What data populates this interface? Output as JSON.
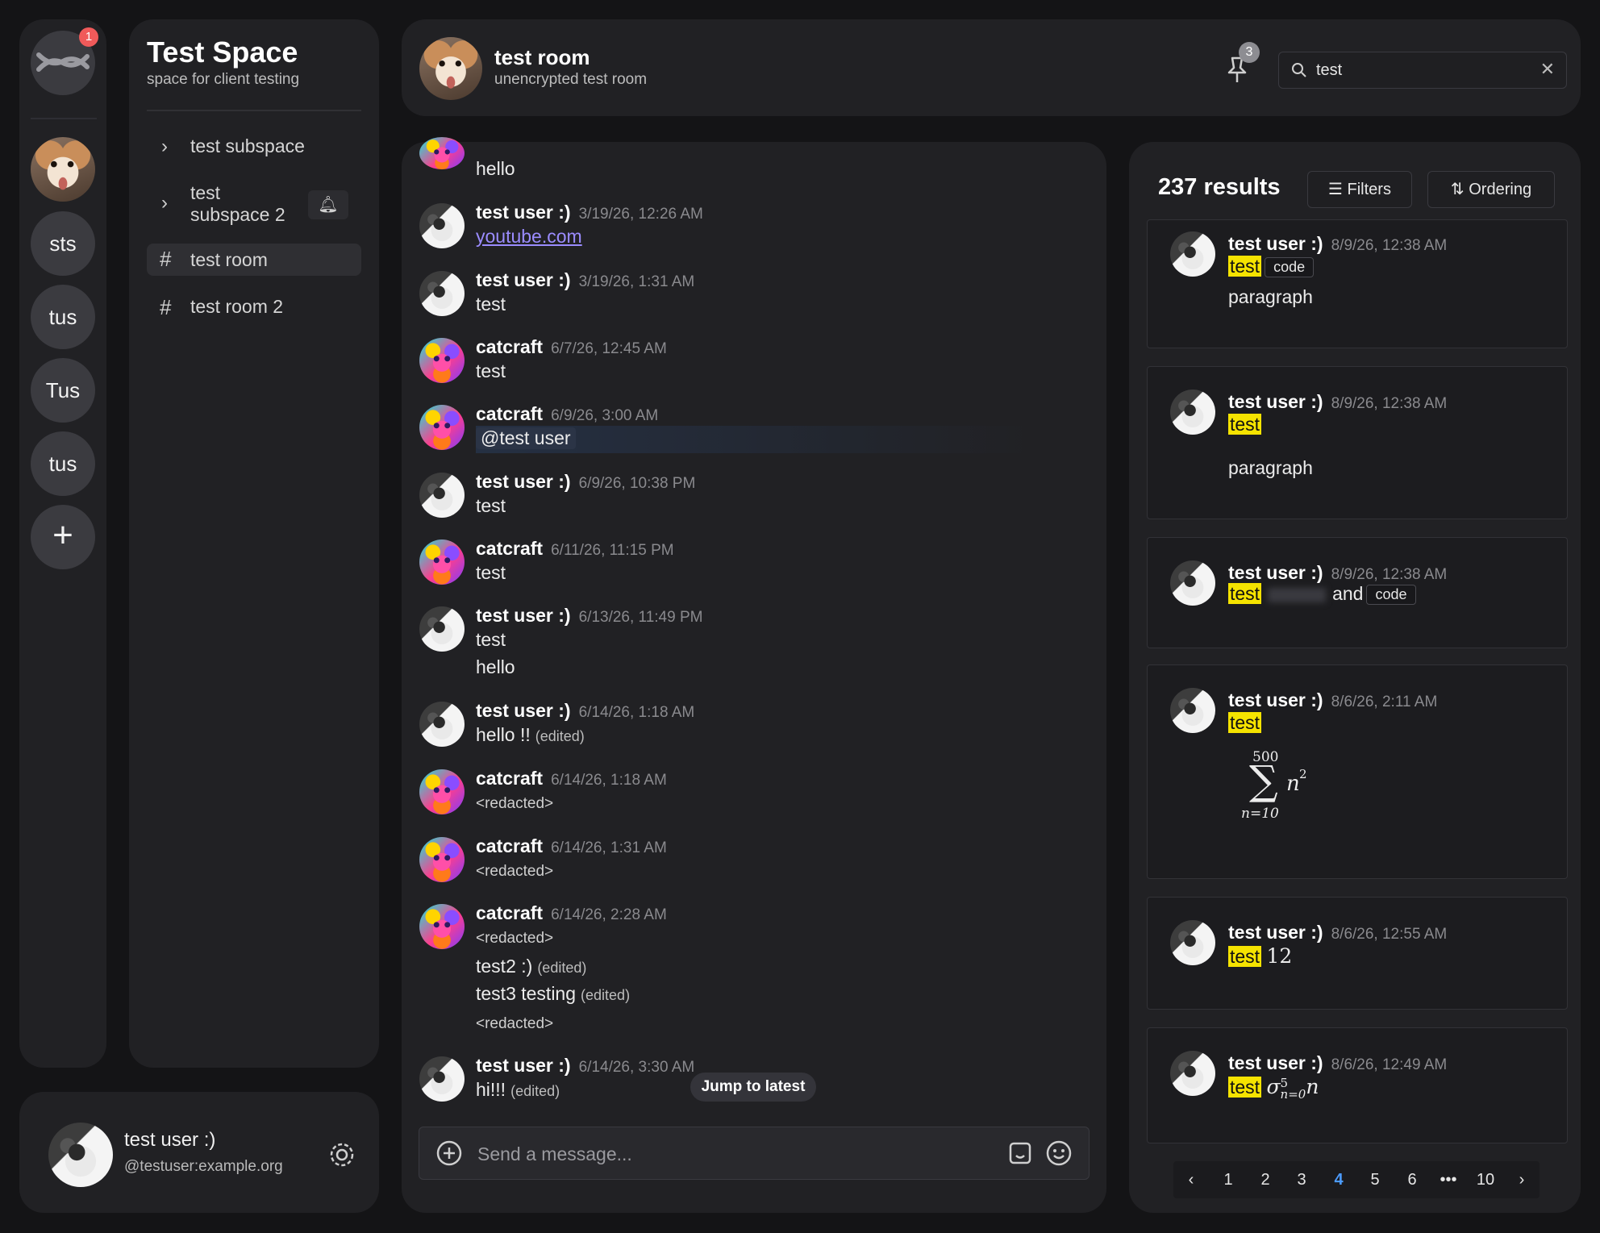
{
  "rail": {
    "notification_badge": "1",
    "spaces": [
      "sts",
      "tus",
      "Tus",
      "tus"
    ],
    "add_label": "+"
  },
  "sidebar": {
    "space_title": "Test Space",
    "space_subtitle": "space for client testing",
    "items": [
      {
        "label": "test subspace",
        "icon": "chevron-right-icon"
      },
      {
        "label_line1": "test",
        "label_line2": "subspace 2",
        "icon": "chevron-right-icon"
      },
      {
        "label": "test room",
        "icon": "hash-icon",
        "active": true
      },
      {
        "label": "test room 2",
        "icon": "hash-icon"
      }
    ]
  },
  "me": {
    "name": "test user :)",
    "id": "@testuser:example.org"
  },
  "header": {
    "room_name": "test room",
    "room_topic": "unencrypted test room",
    "pins_count": "3",
    "search_value": "test"
  },
  "messages": [
    {
      "body": "hello"
    },
    {
      "name": "test user :)",
      "ts": "3/19/26, 12:26 AM",
      "body": "youtube.com"
    },
    {
      "name": "test user :)",
      "ts": "3/19/26, 1:31 AM",
      "body": "test"
    },
    {
      "name": "catcraft",
      "ts": "6/7/26, 12:45 AM",
      "body": "test"
    },
    {
      "name": "catcraft",
      "ts": "6/9/26, 3:00 AM",
      "body": "@test user"
    },
    {
      "name": "test user :)",
      "ts": "6/9/26, 10:38 PM",
      "body": "test"
    },
    {
      "name": "catcraft",
      "ts": "6/11/26, 11:15 PM",
      "body": "test"
    },
    {
      "name": "test user :)",
      "ts": "6/13/26, 11:49 PM",
      "body": "test",
      "body2": "hello"
    },
    {
      "name": "test user :)",
      "ts": "6/14/26, 1:18 AM",
      "body": "hello !!",
      "edited": "(edited)"
    },
    {
      "name": "catcraft",
      "ts": "6/14/26, 1:18 AM",
      "body": "<redacted>"
    },
    {
      "name": "catcraft",
      "ts": "6/14/26, 1:31 AM",
      "body": "<redacted>"
    },
    {
      "name": "catcraft",
      "ts": "6/14/26, 2:28 AM",
      "body": "<redacted>",
      "body2": "test2 :)",
      "body3": "test3 testing",
      "body4": "<redacted>",
      "edited": "(edited)"
    },
    {
      "name": "test user :)",
      "ts": "6/14/26, 3:30 AM",
      "body": "hi!!!",
      "edited": "(edited)"
    }
  ],
  "jump_to_latest": "Jump to latest",
  "composer": {
    "placeholder": "Send a message..."
  },
  "results": {
    "count": "237 results",
    "filters_label": "Filters",
    "ordering_label": "Ordering",
    "cards": [
      {
        "name": "test user :)",
        "ts": "8/9/26, 12:38 AM",
        "hl": "test",
        "code": "code",
        "extra": "paragraph"
      },
      {
        "name": "test user :)",
        "ts": "8/9/26, 12:38 AM",
        "hl": "test",
        "extra": "paragraph"
      },
      {
        "name": "test user :)",
        "ts": "8/9/26, 12:38 AM",
        "hl": "test",
        "and": "and",
        "code": "code"
      },
      {
        "name": "test user :)",
        "ts": "8/6/26, 2:11 AM",
        "hl": "test",
        "sum_top": "500",
        "sum_bottom": "n=10",
        "sum_term": "n",
        "sum_exp": "2"
      },
      {
        "name": "test user :)",
        "ts": "8/6/26, 12:55 AM",
        "hl": "test",
        "extra": "12"
      },
      {
        "name": "test user :)",
        "ts": "8/6/26, 12:49 AM",
        "hl": "test",
        "sigma": "σ",
        "sigma_sup": "5",
        "sigma_sub": "n=0",
        "sigma_term": "n"
      }
    ],
    "pages": [
      "1",
      "2",
      "3",
      "4",
      "5",
      "6",
      "•••",
      "10"
    ],
    "current_page": "4"
  }
}
